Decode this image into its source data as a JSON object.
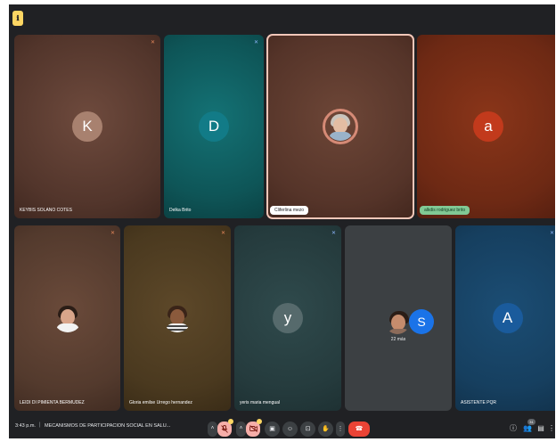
{
  "info_badge": {
    "label": "ℹ"
  },
  "participants": {
    "keybis": {
      "name": "KEYBIS SOLANO COTES",
      "initial": "K",
      "avatar_color": "#a8816f",
      "tile_color": "#5e3d31"
    },
    "delkis": {
      "name": "Delka Brito",
      "initial": "D",
      "avatar_color": "#127b87",
      "tile_color": "#0e5a5c"
    },
    "cliferlina": {
      "name": "Cliferlina mezo",
      "tile_color": "#5c3a2e"
    },
    "alcides": {
      "name": "alkdis rodriguez brito",
      "initial": "a",
      "avatar_color": "#c23a1c",
      "tile_color": "#7a2e1a"
    },
    "leidi": {
      "name": "LEIDI DI PIMIENTA BERMUDEZ",
      "tile_color": "#5b3d2f"
    },
    "gloria": {
      "name": "Gloria emilse Urrego hernandez",
      "tile_color": "#4f3c22"
    },
    "yeris": {
      "name": "yeris maria mengual",
      "initial": "y",
      "avatar_color": "#566a6c",
      "tile_color": "#283f41"
    },
    "others": {
      "count_label": "22 más",
      "initial": "S",
      "avatar_color": "#1a73e8",
      "tile_color": "#3c4043"
    },
    "asistente": {
      "name": "ASISTENTE PQR",
      "initial": "A",
      "avatar_color": "#1a5b9c",
      "tile_color": "#153e5e"
    }
  },
  "bottom_bar": {
    "time": "3:43 p.m.",
    "separator": "|",
    "meeting_title": "MECANISMOS DE PARTICIPACION SOCIAL EN SALU...",
    "participant_count": "31",
    "icons": {
      "mic": "mic-off-icon",
      "camera": "camera-off-icon",
      "captions": "captions-icon",
      "emoji": "emoji-icon",
      "present": "present-icon",
      "raise_hand": "hand-icon",
      "more": "more-vertical-icon",
      "end_call": "end-call-icon",
      "info": "info-icon",
      "people": "people-icon",
      "chat": "chat-icon",
      "activities": "activities-icon"
    }
  }
}
